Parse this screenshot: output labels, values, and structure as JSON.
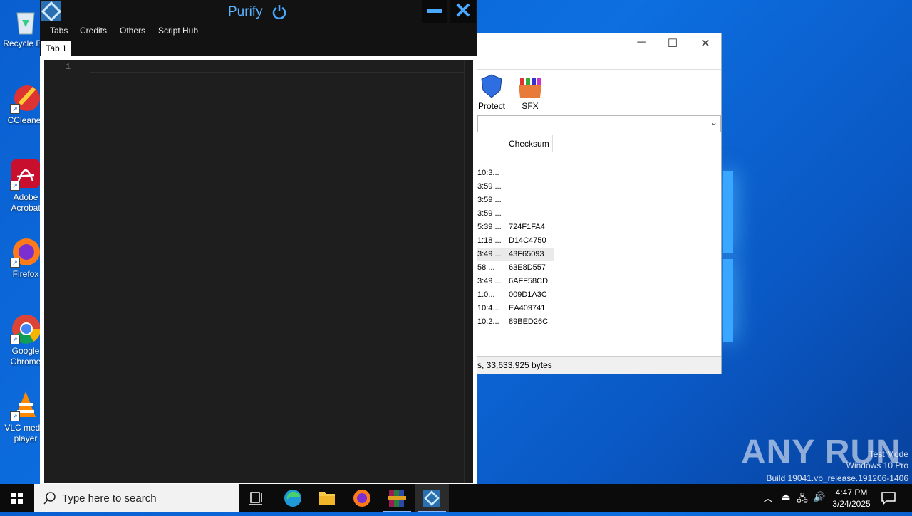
{
  "desktop": {
    "icons": [
      {
        "label": "Recycle Bin",
        "icon": "recycle-bin-icon"
      },
      {
        "label": "CCleaner",
        "icon": "ccleaner-icon"
      },
      {
        "label": "Adobe Acrobat",
        "icon": "adobe-acrobat-icon"
      },
      {
        "label": "Firefox",
        "icon": "firefox-icon"
      },
      {
        "label": "Google Chrome",
        "icon": "chrome-icon"
      },
      {
        "label": "VLC media player",
        "icon": "vlc-icon"
      }
    ]
  },
  "archive_window": {
    "toolbar": [
      {
        "label": "Protect",
        "icon": "shield-icon"
      },
      {
        "label": "SFX",
        "icon": "sfx-archive-icon"
      }
    ],
    "columns": [
      "Checksum"
    ],
    "rows": [
      {
        "date": "10:3...",
        "checksum": ""
      },
      {
        "date": "3:59 ...",
        "checksum": ""
      },
      {
        "date": "3:59 ...",
        "checksum": ""
      },
      {
        "date": "3:59 ...",
        "checksum": ""
      },
      {
        "date": "5:39 ...",
        "checksum": "724F1FA4"
      },
      {
        "date": "1:18 ...",
        "checksum": "D14C4750"
      },
      {
        "date": "3:49 ...",
        "checksum": "43F65093"
      },
      {
        "date": "58 ...",
        "checksum": "63E8D557"
      },
      {
        "date": "3:49 ...",
        "checksum": "6AFF58CD"
      },
      {
        "date": "1:0...",
        "checksum": "009D1A3C"
      },
      {
        "date": "10:4...",
        "checksum": "EA409741"
      },
      {
        "date": "10:2...",
        "checksum": "89BED26C"
      }
    ],
    "selected_row": 6,
    "status": "s, 33,633,925 bytes"
  },
  "purify": {
    "title": "Purify",
    "menu": [
      "Tabs",
      "Credits",
      "Others",
      "Script Hub"
    ],
    "tabs": [
      "Tab 1"
    ],
    "editor": {
      "line_numbers": [
        "1"
      ],
      "content": ""
    },
    "accent": "#4aa8ff"
  },
  "watermark": {
    "logo": "ANY RUN",
    "lines": [
      "Test Mode",
      "Windows 10 Pro",
      "Build 19041.vb_release.191206-1406"
    ]
  },
  "taskbar": {
    "search_placeholder": "Type here to search",
    "apps": [
      "task-view-icon",
      "edge-icon",
      "file-explorer-icon",
      "firefox-icon",
      "winrar-icon",
      "purify-icon"
    ],
    "active_app": "purify-icon",
    "clock_time": "4:47 PM",
    "clock_date": "3/24/2025"
  }
}
